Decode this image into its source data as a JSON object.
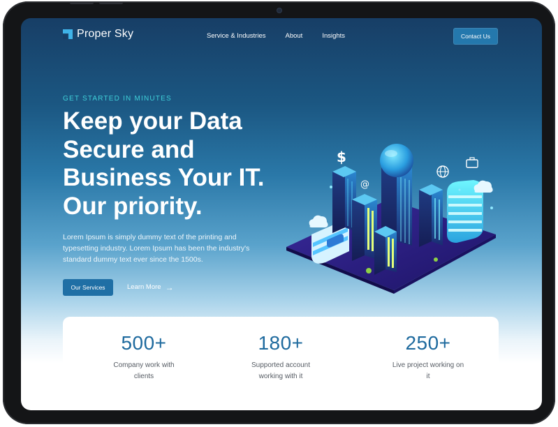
{
  "brand": {
    "name": "Proper Sky"
  },
  "nav": {
    "links": [
      "Service & Industries",
      "About",
      "Insights"
    ],
    "contact_label": "Contact Us"
  },
  "hero": {
    "eyebrow": "GET STARTED IN MINUTES",
    "headline": "Keep your Data Secure and Business Your IT. Our priority.",
    "description": "Lorem Ipsum is simply dummy text of the printing and typesetting industry. Lorem Ipsum has been the industry's standard dummy text ever since the 1500s.",
    "primary_cta": "Our Services",
    "secondary_cta": "Learn More"
  },
  "stats": [
    {
      "value": "500+",
      "label": "Company work with clients"
    },
    {
      "value": "180+",
      "label": "Supported account working with it"
    },
    {
      "value": "250+",
      "label": "Live project working on it"
    }
  ],
  "illustration": {
    "icons": [
      "dollar-icon",
      "at-icon",
      "globe-icon",
      "briefcase-icon",
      "cloud-icon"
    ],
    "symbols": {
      "dollar": "$",
      "at": "@"
    }
  },
  "colors": {
    "accent": "#2478ad",
    "eyebrow": "#3fd0d9",
    "stat_number": "#1e6a9e",
    "background_top": "#173e66"
  }
}
